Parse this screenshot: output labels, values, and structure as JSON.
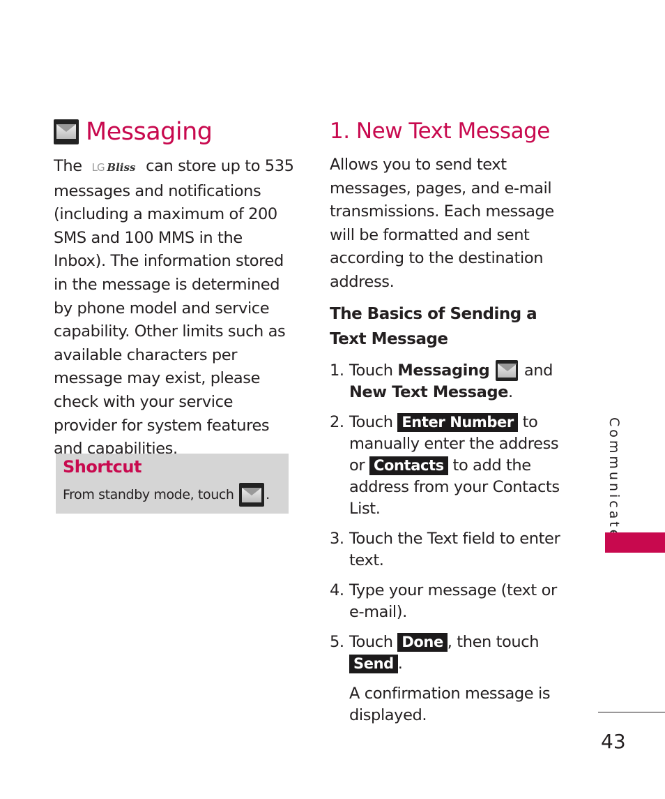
{
  "left": {
    "title": "Messaging",
    "title_icon": "messaging-envelope-icon",
    "intro_prefix": "The",
    "brand_lg": "LG",
    "brand_name": "Bliss",
    "intro_rest": " can store up to 535 messages and notifications (including a maximum of 200 SMS and 100 MMS in the Inbox). The information stored in the message is determined by phone model and service capability. Other limits such as available characters per message may exist, please check with your service provider for system features and capabilities.",
    "shortcut": {
      "title": "Shortcut",
      "text": "From standby mode, touch",
      "icon": "messaging-envelope-icon",
      "suffix": "."
    }
  },
  "right": {
    "title": "1. New Text Message",
    "description": "Allows you to send text messages, pages, and e-mail transmissions. Each message will be formatted and sent according to the destination address.",
    "subheading": "The Basics of Sending a Text Message",
    "steps": [
      {
        "num": "1.",
        "a": "Touch ",
        "b": "Messaging",
        "c": " and",
        "d": "New Text Message",
        "e": "."
      },
      {
        "num": "2.",
        "a": "Touch ",
        "key1": "Enter Number",
        "b": " to manually enter the address or ",
        "key2": "Contacts",
        "c": " to add the address from your Contacts List."
      },
      {
        "num": "3.",
        "text": "Touch the Text field to enter text."
      },
      {
        "num": "4.",
        "text": "Type your message (text or e-mail)."
      },
      {
        "num": "5.",
        "a": "Touch ",
        "key1": "Done",
        "b": ", then touch ",
        "key2": "Send",
        "c": "."
      }
    ],
    "note": "A confirmation message is displayed."
  },
  "side": {
    "section": "Communicate",
    "accent": "#c8094e"
  },
  "page_number": "43"
}
